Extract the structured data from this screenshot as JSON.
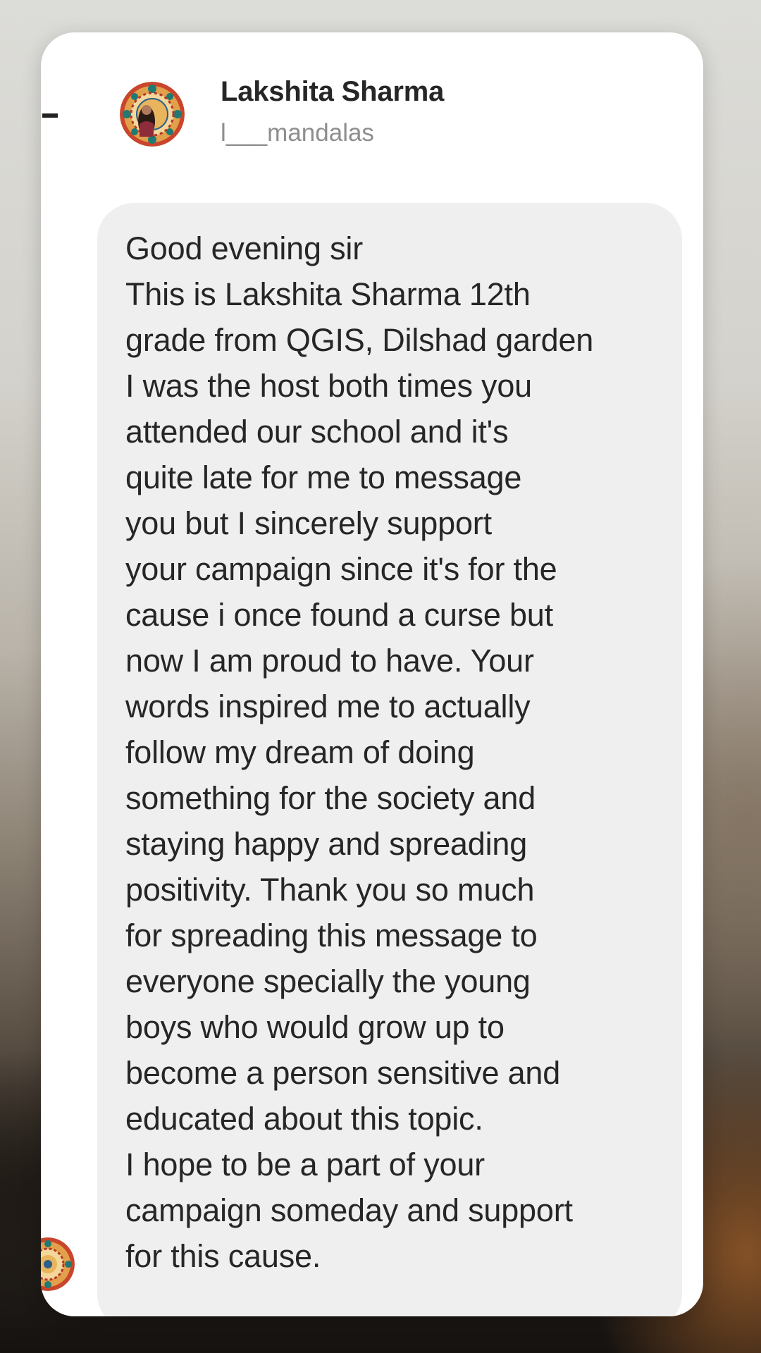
{
  "sender": {
    "name": "Lakshita Sharma",
    "username": "l___mandalas",
    "avatar_icon": "mandala-profile-avatar"
  },
  "message": {
    "lines": [
      "Good evening sir",
      "This is Lakshita Sharma 12th",
      "grade from QGIS, Dilshad garden",
      "I was the host both times you",
      "attended our school and it's",
      "quite late for me to message",
      "you but I sincerely support",
      "your campaign since it's for the",
      "cause i once found a curse but",
      "now I am proud to have. Your",
      "words inspired me to actually",
      "follow my dream of doing",
      "something for the society and",
      "staying happy and spreading",
      "positivity. Thank you so much",
      "for spreading this message to",
      "everyone specially the young",
      "boys who would grow up to",
      "become a person sensitive and",
      "educated about this topic.",
      "I hope to be a part of your",
      "campaign someday and support",
      "for this cause."
    ]
  },
  "colors": {
    "bubble": "#efefef",
    "name_text": "#262626",
    "handle_text": "#8e8e8e",
    "card": "#ffffff"
  }
}
